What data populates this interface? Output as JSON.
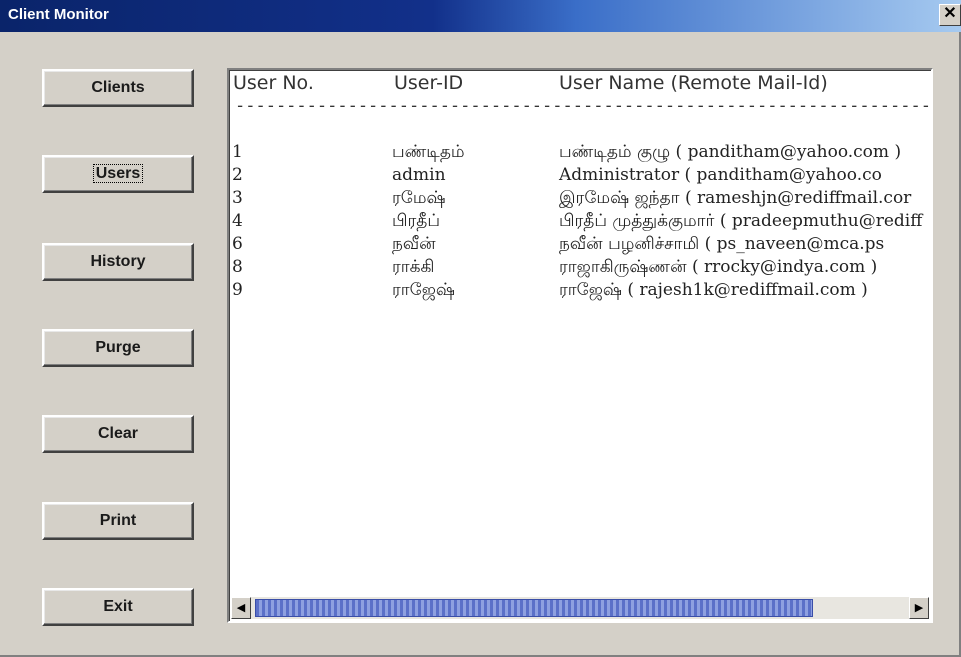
{
  "window": {
    "title": "Client Monitor",
    "close_symbol": "✕"
  },
  "buttons": {
    "clients": "Clients",
    "users": "Users",
    "history": "History",
    "purge": "Purge",
    "clear": "Clear",
    "print": "Print",
    "exit": "Exit"
  },
  "list": {
    "headers": {
      "user_no": "User No.",
      "user_id": "User-ID",
      "user_name": "User Name (Remote Mail-Id)"
    },
    "separator": "----------------------------------------------------------------------------",
    "rows": [
      {
        "no": "1",
        "id": "பண்டிதம்",
        "name": "பண்டிதம் குழு ( panditham@yahoo.com )"
      },
      {
        "no": "2",
        "id": "admin",
        "name": "Administrator ( panditham@yahoo.co"
      },
      {
        "no": "3",
        "id": "ரமேஷ்",
        "name": "இரமேஷ் ஜந்தா ( rameshjn@rediffmail.cor"
      },
      {
        "no": "4",
        "id": "பிரதீப்",
        "name": "பிரதீப் முத்துக்குமார் ( pradeepmuthu@rediff"
      },
      {
        "no": "6",
        "id": "நவீன்",
        "name": "நவீன் பழனிச்சாமி ( ps_naveen@mca.ps"
      },
      {
        "no": "8",
        "id": "ராக்கி",
        "name": "ராஜாகிருஷ்ணன் ( rrocky@indya.com )"
      },
      {
        "no": "9",
        "id": "ராஜேஷ்",
        "name": "ராஜேஷ் ( rajesh1k@rediffmail.com )"
      }
    ]
  },
  "scrollbar": {
    "left_arrow": "◀",
    "right_arrow": "▶"
  }
}
